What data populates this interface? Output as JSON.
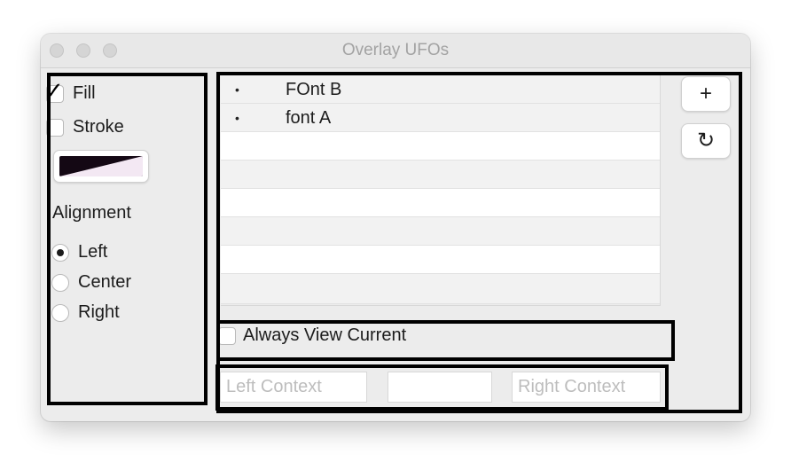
{
  "window": {
    "title": "Overlay UFOs"
  },
  "sidebar": {
    "fill": {
      "label": "Fill",
      "checked": true
    },
    "stroke": {
      "label": "Stroke",
      "checked": false
    },
    "color_swatch": {
      "colors": [
        "#140814",
        "#f3e8f3"
      ]
    },
    "alignment": {
      "heading": "Alignment",
      "options": [
        {
          "label": "Left",
          "selected": true
        },
        {
          "label": "Center",
          "selected": false
        },
        {
          "label": "Right",
          "selected": false
        }
      ]
    }
  },
  "font_list": {
    "rows": [
      {
        "bullet": "•",
        "name": "FOnt B"
      },
      {
        "bullet": "•",
        "name": "font A"
      }
    ]
  },
  "buttons": {
    "add": "+",
    "reset": "↻"
  },
  "always_view_current": {
    "label": "Always View Current",
    "checked": false
  },
  "context": {
    "left_placeholder": "Left Context",
    "center_value": "",
    "right_placeholder": "Right Context"
  }
}
